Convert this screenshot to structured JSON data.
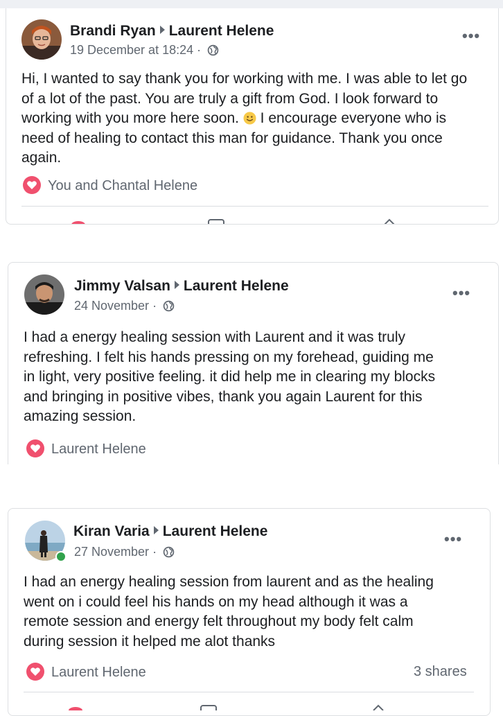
{
  "posts": [
    {
      "author": "Brandi Ryan",
      "target": "Laurent Helene",
      "date": "19 December at 18:24",
      "separator": "·",
      "text_lines": [
        "Hi, I wanted to say thank you for working with me. I was able to let go",
        "of a lot of the past. You are truly a gift from God. I look forward to",
        "working with you more here soon.",
        " I encourage everyone who is",
        "need of healing to contact this man for guidance. Thank you once",
        "again."
      ],
      "reactions": "You and Chantal Helene"
    },
    {
      "author": "Jimmy Valsan",
      "target": "Laurent Helene",
      "date": "24 November",
      "separator": "·",
      "text_lines": [
        "I had a energy healing session with Laurent and it was truly",
        "refreshing. I felt his hands pressing on my forehead, guiding me",
        "in light, very positive feeling. it did help me in clearing my blocks",
        "and bringing in positive vibes, thank you again Laurent for this",
        "amazing session."
      ],
      "reactions": "Laurent Helene"
    },
    {
      "author": "Kiran Varia",
      "target": "Laurent Helene",
      "date": "27 November",
      "separator": "·",
      "text_lines": [
        "I had an energy healing session from laurent and as the healing",
        "went on i could feel his hands on my head although it was a",
        "remote session and energy felt throughout my body felt calm",
        "during session it helped me alot thanks"
      ],
      "reactions": "Laurent Helene",
      "shares": "3 shares"
    }
  ],
  "more_label": "•••",
  "icons": {
    "globe": "globe-icon",
    "reaction": "heart-icon",
    "more": "more-options-icon",
    "smiley": "smiley-emoji-icon"
  },
  "colors": {
    "reaction_heart": "#f0506e",
    "online": "#31a24c",
    "meta_text": "#606770"
  }
}
